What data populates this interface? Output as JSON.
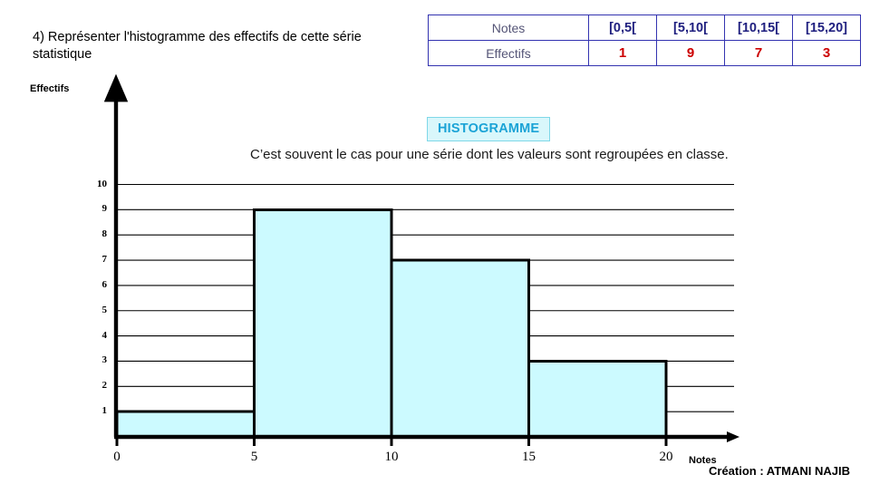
{
  "question": {
    "text": "4) Représenter l'histogramme des effectifs de cette série statistique"
  },
  "table": {
    "row_labels": [
      "Notes",
      "Effectifs"
    ],
    "classes": [
      "[0,5[",
      "[5,10[",
      "[10,15[",
      "[15,20]"
    ],
    "counts": [
      "1",
      "9",
      "7",
      "3"
    ],
    "header_color": "#202080",
    "value_color": "#cc0000",
    "border_color": "#3333b0"
  },
  "badge": {
    "label": "HISTOGRAMME",
    "text_color": "#1ba3d6",
    "background_color": "#d9f7fb",
    "border_color": "#7fd8e8"
  },
  "description": {
    "text": "C’est souvent le cas pour une série dont les valeurs sont regroupées en classe."
  },
  "credit": {
    "text": "Création : ATMANI NAJIB"
  },
  "chart_data": {
    "type": "bar",
    "title": "",
    "xlabel": "Notes",
    "ylabel": "Effectifs",
    "categories": [
      "[0,5[",
      "[5,10[",
      "[10,15[",
      "[15,20]"
    ],
    "bin_edges": [
      0,
      5,
      10,
      15,
      20
    ],
    "values": [
      1,
      9,
      7,
      3
    ],
    "xlim": [
      0,
      20
    ],
    "ylim": [
      0,
      10
    ],
    "xticks": [
      "0",
      "5",
      "10",
      "15",
      "20"
    ],
    "yticks": [
      "1",
      "2",
      "3",
      "4",
      "5",
      "6",
      "7",
      "8",
      "9",
      "10"
    ],
    "grid": true,
    "legend": "none",
    "bar_fill_color": "#ccfaff",
    "bar_stroke_color": "#000000",
    "axis_color": "#000000"
  }
}
